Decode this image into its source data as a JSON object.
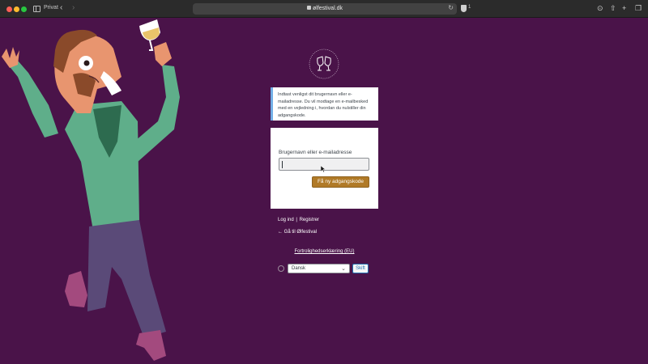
{
  "browser": {
    "private_label": "Privat",
    "url": "ølfestival.dk",
    "shield_count": "1"
  },
  "login": {
    "message": "Indtast venligst dit brugernavn eller e-mailadresse. Du vil modtage en e-mailbesked med en vejledning i, hvordan du nulstiller din adgangskode.",
    "field_label": "Brugernavn eller e-mailadresse",
    "field_value": "",
    "submit_label": "Få ny adgangskode"
  },
  "nav": {
    "login_link": "Log ind",
    "separator": "|",
    "register_link": "Registrer",
    "back_link": "← Gå til Ølfestival"
  },
  "privacy_link": "Fortrolighedserklæring (EU)",
  "language": {
    "selected": "Dansk",
    "switch_label": "Skift"
  },
  "colors": {
    "background": "#4a1349",
    "button": "#b07a27",
    "shirt": "#5fae8a",
    "pants": "#5a4a78",
    "shoes": "#a34a7e"
  }
}
